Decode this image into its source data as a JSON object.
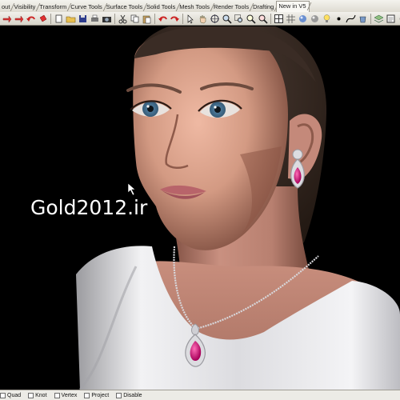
{
  "toolbar_tabs": [
    {
      "label": "out",
      "active": false
    },
    {
      "label": "Visibility",
      "active": false
    },
    {
      "label": "Transform",
      "active": false
    },
    {
      "label": "Curve Tools",
      "active": false
    },
    {
      "label": "Surface Tools",
      "active": false
    },
    {
      "label": "Solid Tools",
      "active": false
    },
    {
      "label": "Mesh Tools",
      "active": false
    },
    {
      "label": "Render Tools",
      "active": false
    },
    {
      "label": "Drafting",
      "active": false
    },
    {
      "label": "New in V5",
      "active": true
    }
  ],
  "toolbar_icons": [
    "arrow-icon",
    "arrow-icon",
    "undo-icon",
    "paint-bucket-icon",
    "separator",
    "new-file-icon",
    "open-file-icon",
    "save-icon",
    "print-icon",
    "camera-icon",
    "separator",
    "cut-icon",
    "copy-icon",
    "paste-icon",
    "separator",
    "undo-icon",
    "redo-icon",
    "separator",
    "select-icon",
    "hand-pan-icon",
    "rotate-view-icon",
    "zoom-icon",
    "zoom-window-icon",
    "zoom-extents-icon",
    "zoom-selected-icon",
    "separator",
    "viewport-grid-icon",
    "grid-icon",
    "render-sphere-icon",
    "shade-sphere-icon",
    "light-bulb-icon",
    "point-icon",
    "curve-icon",
    "bucket-icon",
    "separator",
    "layer-icon",
    "properties-icon",
    "options-icon",
    "running-man-icon",
    "command-icon",
    "lasso-icon",
    "bowl-icon",
    "surface-icon",
    "blend-icon"
  ],
  "viewport": {
    "watermark": "Gold2012.ir"
  },
  "statusbar": {
    "osnaps": [
      {
        "label": "Quad",
        "checked": false
      },
      {
        "label": "Knot",
        "checked": false
      },
      {
        "label": "Vertex",
        "checked": false
      },
      {
        "label": "Project",
        "checked": false
      },
      {
        "label": "Disable",
        "checked": false
      }
    ]
  },
  "colors": {
    "toolbar_bg": "#e4e1d7",
    "viewport_bg": "#000000",
    "gem": "#d2157a",
    "metal": "#d8d8dc"
  }
}
